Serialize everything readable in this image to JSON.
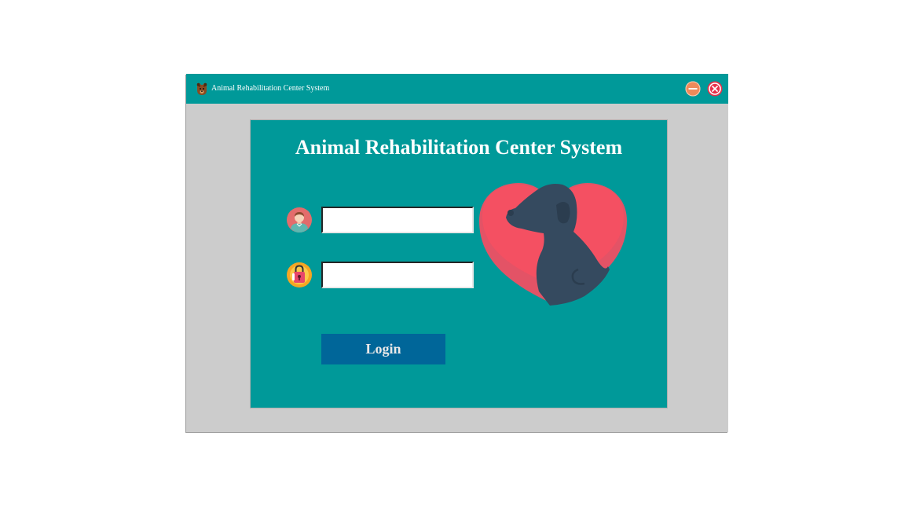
{
  "window": {
    "title": "Animal Rehabilitation Center System",
    "app_icon": "dog-icon",
    "controls": [
      "minimize-icon",
      "close-icon"
    ]
  },
  "login": {
    "heading": "Animal Rehabilitation Center System",
    "username": {
      "value": "",
      "placeholder": "",
      "icon": "user-icon"
    },
    "password": {
      "value": "",
      "placeholder": "",
      "icon": "key-icon"
    },
    "button_label": "Login",
    "illustration": "dog-heart-icon"
  },
  "colors": {
    "titlebar": "#009999",
    "panel": "#009999",
    "window_bg": "#cccccc",
    "button": "#006699",
    "heart": "#f45062",
    "dog": "#354a5f",
    "minimize": "#ef8a5a",
    "close": "#e8304a"
  }
}
